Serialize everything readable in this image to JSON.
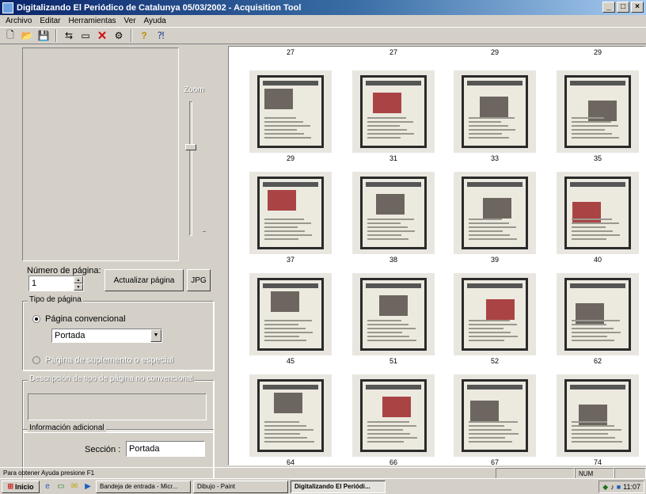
{
  "window": {
    "title": "Digitalizando El Periódico de Catalunya 05/03/2002 - Acquisition Tool",
    "buttons": {
      "minimize": "_",
      "maximize": "□",
      "close": "×"
    }
  },
  "menu": [
    "Archivo",
    "Editar",
    "Herramientas",
    "Ver",
    "Ayuda"
  ],
  "toolbar": {
    "icons": [
      "new-document-icon",
      "open-folder-icon",
      "save-icon",
      "move-pages-icon",
      "scan-icon",
      "delete-icon",
      "settings-icon",
      "help-icon",
      "context-help-icon"
    ],
    "glyphs": [
      "🗋",
      "📂",
      "💾",
      "⇆",
      "▭",
      "✕",
      "⚙",
      "?",
      "⁈"
    ]
  },
  "left": {
    "zoom_label": "Zoom",
    "page_number_label": "Número de página:",
    "page_number_value": "1",
    "update_button": "Actualizar página",
    "jpg_button": "JPG",
    "page_type_label": "Tipo de página",
    "conventional_radio": "Página convencional",
    "page_type_value": "Portada",
    "special_radio": "Página de suplemento o especial",
    "description_label": "Descripción de tipo de página no convencional",
    "extra_info_label": "Información adicional",
    "section_label": "Sección :",
    "section_value": "Portada"
  },
  "thumbnails": {
    "columns_pixel_note": "",
    "items": [
      {
        "num": "27",
        "label": "29"
      },
      {
        "num": "27",
        "label": "31"
      },
      {
        "num": "29",
        "label": "33"
      },
      {
        "num": "29",
        "label": "35"
      },
      {
        "num": "",
        "label": "37"
      },
      {
        "num": "",
        "label": "38"
      },
      {
        "num": "",
        "label": "39"
      },
      {
        "num": "",
        "label": "40"
      },
      {
        "num": "",
        "label": "45"
      },
      {
        "num": "",
        "label": "51"
      },
      {
        "num": "",
        "label": "52"
      },
      {
        "num": "",
        "label": "62"
      },
      {
        "num": "",
        "label": "64"
      },
      {
        "num": "",
        "label": "66"
      },
      {
        "num": "",
        "label": "67"
      },
      {
        "num": "",
        "label": "74"
      }
    ]
  },
  "status": {
    "text": "Para obtener Ayuda presione F1",
    "panels": [
      "",
      "NUM",
      ""
    ]
  },
  "taskbar": {
    "start": "Inicio",
    "quick_launch": [
      "ie-icon",
      "desktop-icon",
      "outlook-icon",
      "media-icon"
    ],
    "tasks": [
      {
        "label": "Bandeja de entrada - Micr...",
        "active": false
      },
      {
        "label": "Dibujo - Paint",
        "active": false
      },
      {
        "label": "Digitalizando El Periódi...",
        "active": true
      }
    ],
    "clock": "11:07"
  }
}
